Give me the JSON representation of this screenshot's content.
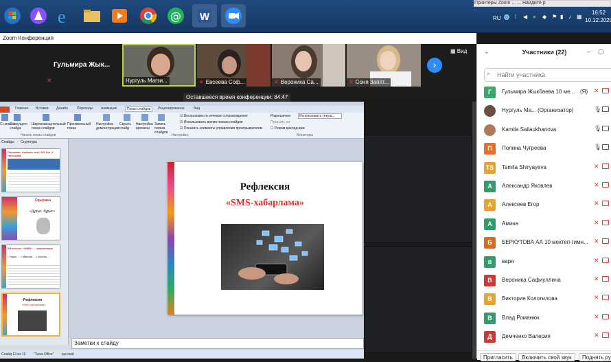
{
  "taskbar": {
    "lang": "RU",
    "time": "16:52",
    "date": "10.12.2020",
    "top_strip": "Принтеры   Zoom ...  ... Найдите р"
  },
  "zoom": {
    "title": "Zoom Конференция",
    "view_label": "Вид",
    "time_left": "Оставшееся время конференции: 84:47",
    "tiles": [
      {
        "name": "Гульмира Жык..."
      },
      {
        "name": "Нургуль Магзи..."
      },
      {
        "name": "Евсеева Соф..."
      },
      {
        "name": "Вероника Са..."
      },
      {
        "name": "Соня Запят..."
      }
    ]
  },
  "ppt": {
    "tabs": [
      "Главная",
      "Вставка",
      "Дизайн",
      "Переходы",
      "Анимация",
      "Показ слайдов",
      "Рецензирование",
      "Вид"
    ],
    "ribbon": {
      "g1": "С начала",
      "g2": "С текущего слайда",
      "g3": "Широковещательный показ слайдов",
      "g4": "Произвольный показ",
      "group_start": "Начать показ слайдов",
      "b1": "Настройка демонстрации",
      "b2": "Скрыть слайд",
      "b3": "Настройка времени",
      "b4": "Запись показа слайдов",
      "c1": "Воспроизвести речевое сопровождение",
      "c2": "Использовать время показа слайдов",
      "c3": "Показать элементы управления проигрывателем",
      "group_setup": "Настройка",
      "r1": "Разрешение:",
      "r1v": "Использовать текущ...",
      "r2": "Показать на:",
      "r3": "Режим докладчика",
      "group_monitors": "Мониторы"
    },
    "panel_tabs": [
      "Слайды",
      "Структура"
    ],
    "thumbs": [
      {
        "num": "",
        "title": "Оқырман: Ақпарат көзі, 135 бет, 2 тапсырма",
        "sub": ""
      },
      {
        "num": "",
        "title": "Оқырман",
        "sub": "«Дұрыс, бұрыс»"
      },
      {
        "num": "",
        "title": "Айтылым: «ЖЖБ» ... формалары",
        "sub": "• Уақыт ... • Мағына ... • Кірістір ..."
      },
      {
        "num": "",
        "title": "Рефлексия",
        "sub": "«SMS-хабарлама»"
      }
    ],
    "slide_title": "Рефлексия",
    "slide_subtitle": "«SMS-хабарлама»",
    "notes_placeholder": "Заметки к слайду",
    "status_left": "Слайд 13 из 16",
    "status_theme": "\"Тема Office\"",
    "status_lang": "русский"
  },
  "participants": {
    "title": "Участники (22)",
    "search_placeholder": "Найти участника",
    "list": [
      {
        "initial": "Г",
        "color": "#3aa76d",
        "name": "Гульмира Жыкбаева 10 ме...",
        "tag": "(Я)"
      },
      {
        "initial": "",
        "color": "#6b4e3d",
        "name": "Нургуль Ма... (Организатор)",
        "tag": ""
      },
      {
        "initial": "",
        "color": "#b07a5a",
        "name": "Kamila Sailaukhanova",
        "tag": ""
      },
      {
        "initial": "П",
        "color": "#e3702e",
        "name": "Полина Чугреева",
        "tag": ""
      },
      {
        "initial": "TS",
        "color": "#e8a32e",
        "name": "Tamila Shiryayeva",
        "tag": ""
      },
      {
        "initial": "А",
        "color": "#2f9e6b",
        "name": "Александр Яковлев",
        "tag": ""
      },
      {
        "initial": "А",
        "color": "#e8a32e",
        "name": "Алексеев Егор",
        "tag": ""
      },
      {
        "initial": "А",
        "color": "#2f9e6b",
        "name": "Амина",
        "tag": ""
      },
      {
        "initial": "Б",
        "color": "#d96a1e",
        "name": "БЕРКУТОВА АА 10 мектеп-гимн...",
        "tag": ""
      },
      {
        "initial": "в",
        "color": "#2f9e6b",
        "name": "варя",
        "tag": ""
      },
      {
        "initial": "В",
        "color": "#c83c35",
        "name": "Вероника Сафиуллина",
        "tag": ""
      },
      {
        "initial": "В",
        "color": "#e8a32e",
        "name": "Виктория Колотилова",
        "tag": ""
      },
      {
        "initial": "В",
        "color": "#2f9e6b",
        "name": "Влад Романюк",
        "tag": ""
      },
      {
        "initial": "Д",
        "color": "#c83c35",
        "name": "Демченко Валерия",
        "tag": ""
      }
    ],
    "footer": [
      "Пригласить",
      "Включить свой звук",
      "Поднять ру"
    ]
  }
}
